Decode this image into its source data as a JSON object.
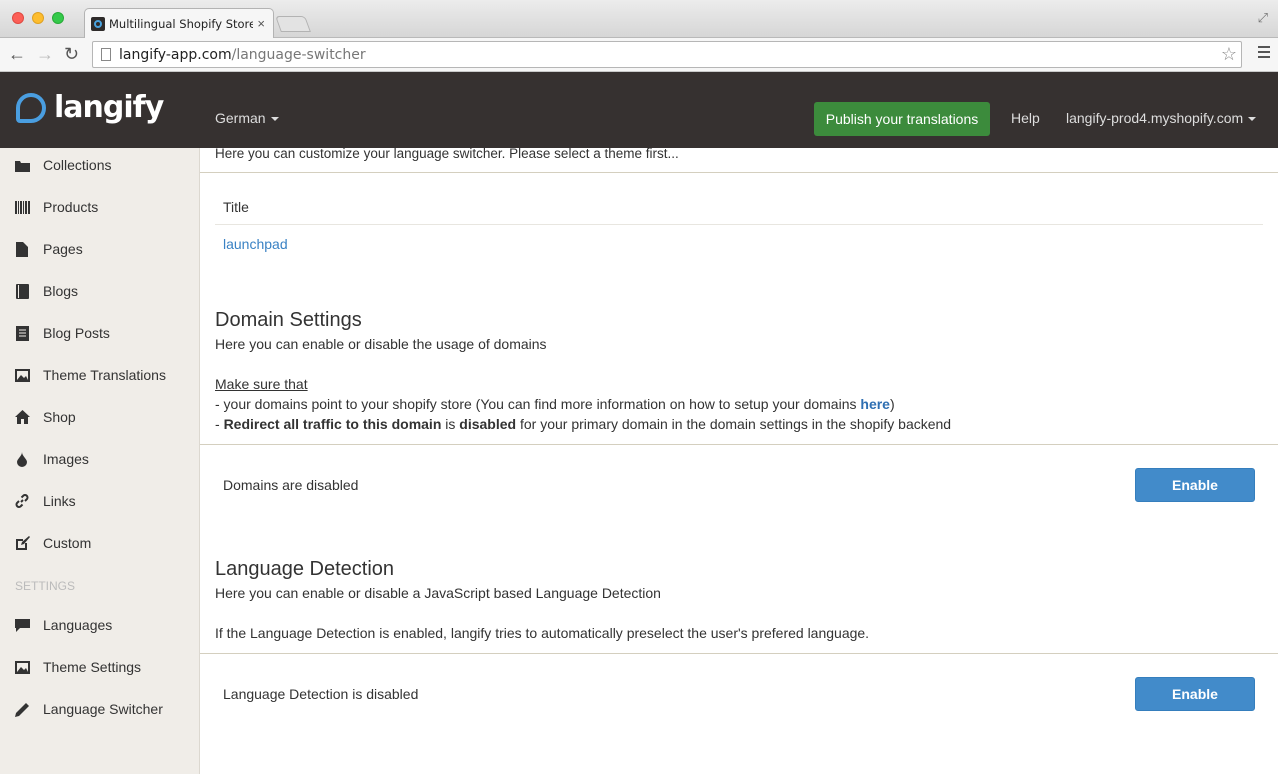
{
  "browser": {
    "tab_title": "Multilingual Shopify Stores",
    "tab_close": "×",
    "url_host": "langify-app.com",
    "url_path": "/language-switcher"
  },
  "header": {
    "logo_text": "langify",
    "language": "German",
    "publish_label": "Publish your translations",
    "help_label": "Help",
    "shop": "langify-prod4.myshopify.com"
  },
  "sidebar": {
    "items": [
      {
        "label": "Collections",
        "icon": "folder-icon"
      },
      {
        "label": "Products",
        "icon": "barcode-icon"
      },
      {
        "label": "Pages",
        "icon": "file-icon"
      },
      {
        "label": "Blogs",
        "icon": "book-icon"
      },
      {
        "label": "Blog Posts",
        "icon": "list-icon"
      },
      {
        "label": "Theme Translations",
        "icon": "picture-icon"
      },
      {
        "label": "Shop",
        "icon": "home-icon"
      },
      {
        "label": "Images",
        "icon": "drop-icon"
      },
      {
        "label": "Links",
        "icon": "link-icon"
      },
      {
        "label": "Custom",
        "icon": "edit-icon"
      }
    ],
    "settings_heading": "SETTINGS",
    "settings_items": [
      {
        "label": "Languages",
        "icon": "comment-icon"
      },
      {
        "label": "Theme Settings",
        "icon": "picture-icon"
      },
      {
        "label": "Language Switcher",
        "icon": "pencil-icon"
      }
    ]
  },
  "main": {
    "intro": "Here you can customize your language switcher. Please select a theme first...",
    "table_header": "Title",
    "theme_name": "launchpad",
    "domain": {
      "title": "Domain Settings",
      "description": "Here you can enable or disable the usage of domains",
      "make_sure": "Make sure that",
      "line1_pre": "- your domains point to your shopify store (You can find more information on how to setup your domains ",
      "line1_link": "here",
      "line1_post": ")",
      "line2_pre": "- ",
      "line2_bold1": "Redirect all traffic to this domain",
      "line2_mid": " is ",
      "line2_bold2": "disabled",
      "line2_post": " for your primary domain in the domain settings in the shopify backend",
      "status": "Domains are disabled",
      "button": "Enable"
    },
    "detection": {
      "title": "Language Detection",
      "description": "Here you can enable or disable a JavaScript based Language Detection",
      "note": "If the Language Detection is enabled, langify tries to automatically preselect the user's prefered language.",
      "status": "Language Detection is disabled",
      "button": "Enable"
    }
  },
  "colors": {
    "header_bg": "#363130",
    "publish_green": "#3c8b3c",
    "enable_blue": "#428bca",
    "sidebar_bg": "#f0ede8",
    "link_blue": "#3a82c4"
  }
}
